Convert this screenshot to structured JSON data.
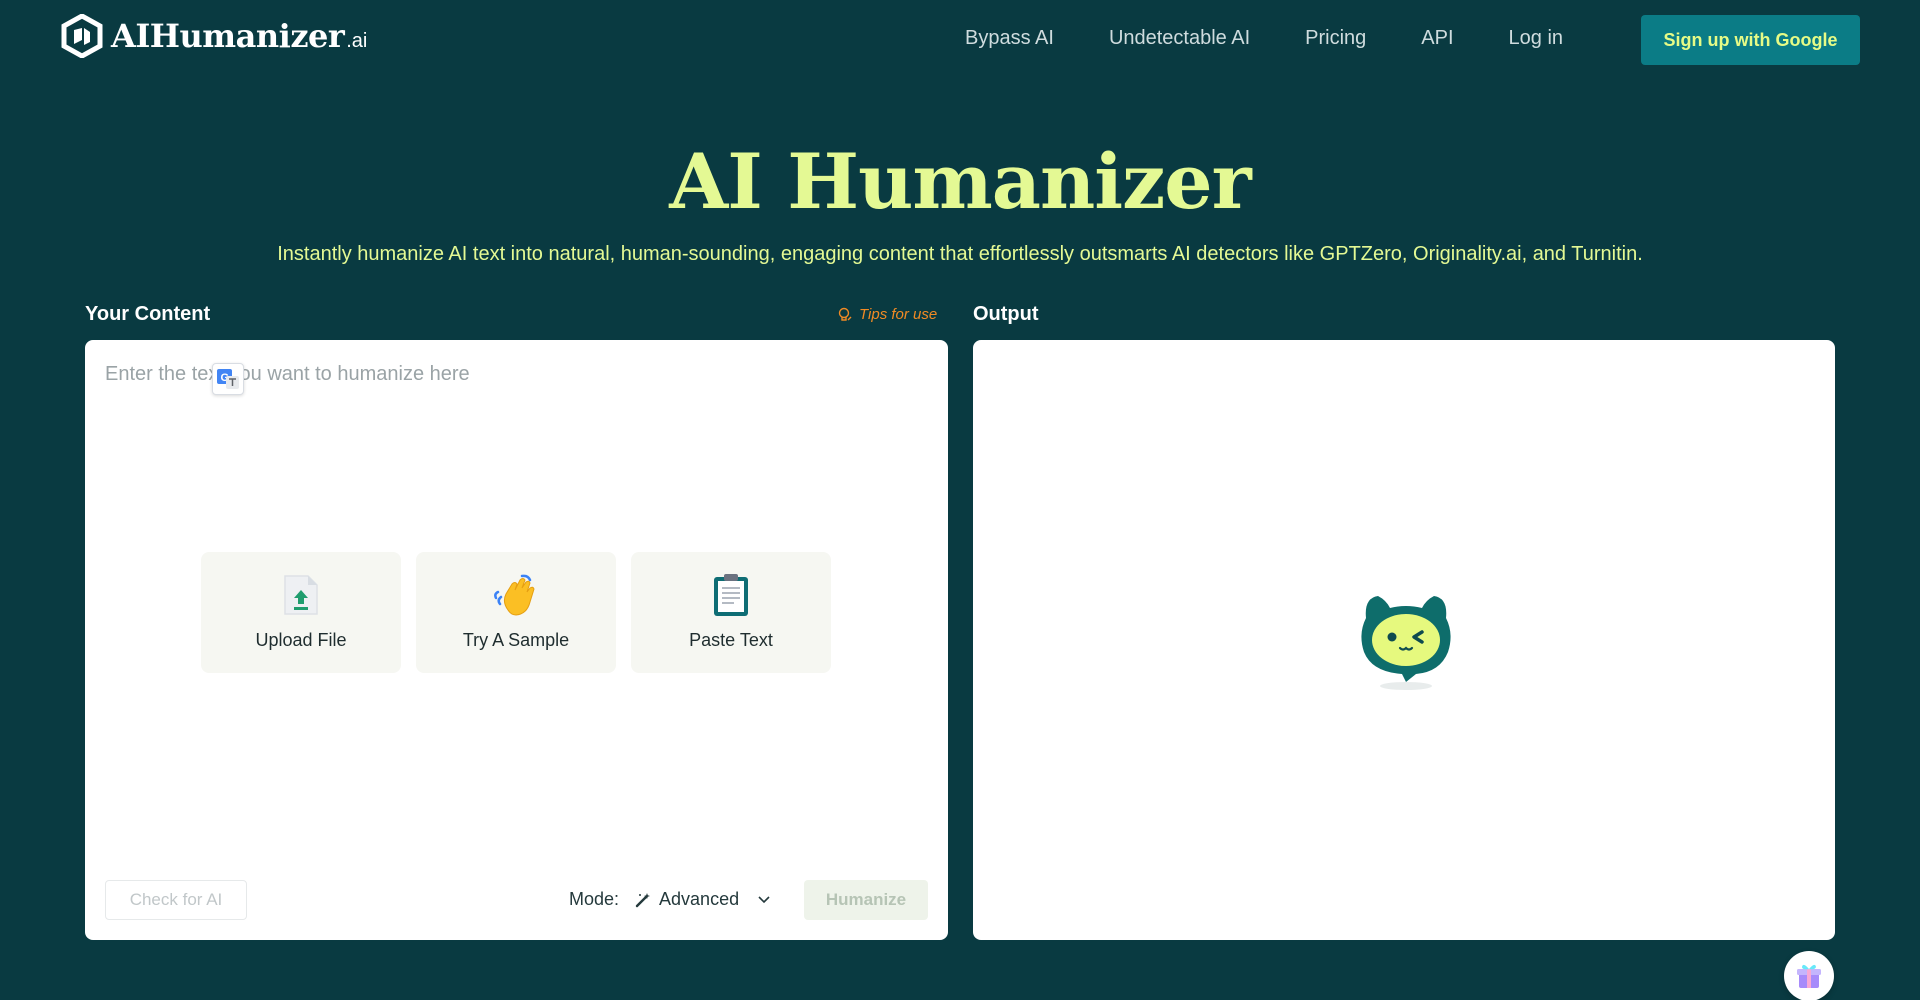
{
  "brand": {
    "name": "AIHumanizer",
    "suffix": ".ai"
  },
  "nav": {
    "items": [
      "Bypass AI",
      "Undetectable AI",
      "Pricing",
      "API",
      "Log in"
    ],
    "signup_label": "Sign up with Google"
  },
  "hero": {
    "title": "AI Humanizer",
    "subtitle": "Instantly humanize AI text into natural, human-sounding, engaging content that effortlessly outsmarts AI detectors like GPTZero, Originality.ai, and Turnitin."
  },
  "input_panel": {
    "label": "Your Content",
    "tips_label": "Tips for use",
    "placeholder": "Enter the text you want to humanize here",
    "actions": [
      {
        "label": "Upload File",
        "icon": "upload-file-icon"
      },
      {
        "label": "Try A Sample",
        "icon": "waving-hand-icon"
      },
      {
        "label": "Paste Text",
        "icon": "clipboard-icon"
      }
    ],
    "check_label": "Check for AI",
    "mode_label": "Mode:",
    "mode_value": "Advanced",
    "humanize_label": "Humanize"
  },
  "output_panel": {
    "label": "Output"
  },
  "colors": {
    "background": "#093a41",
    "accent": "#e4f994",
    "button": "#0b7c86",
    "tips": "#f08a24"
  }
}
